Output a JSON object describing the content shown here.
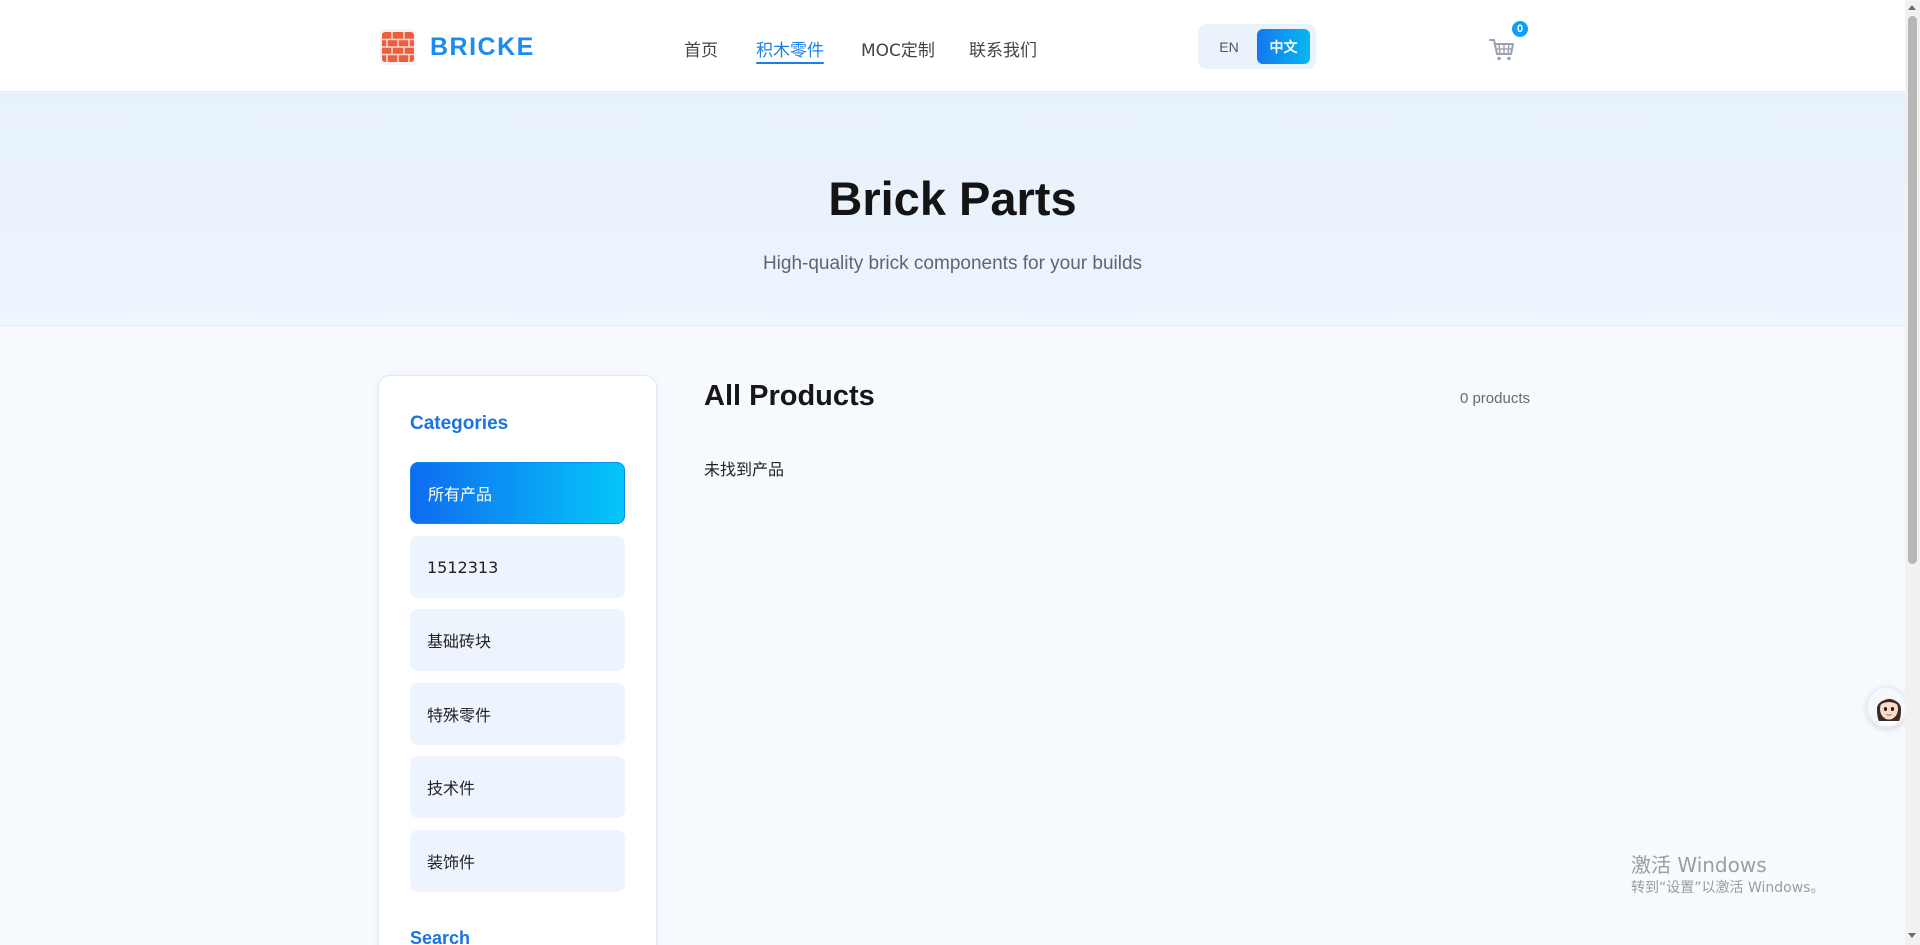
{
  "header": {
    "logo_text": "BRICKE",
    "nav": [
      {
        "label": "首页",
        "active": false
      },
      {
        "label": "积木零件",
        "active": true
      },
      {
        "label": "MOC定制",
        "active": false
      },
      {
        "label": "联系我们",
        "active": false
      }
    ],
    "lang": {
      "en": "EN",
      "zh": "中文",
      "selected": "中文"
    },
    "cart_count": "0"
  },
  "hero": {
    "title": "Brick Parts",
    "subtitle": "High-quality brick components for your builds"
  },
  "sidebar": {
    "categories_heading": "Categories",
    "categories": [
      {
        "label": "所有产品",
        "active": true
      },
      {
        "label": "1512313",
        "active": false
      },
      {
        "label": "基础砖块",
        "active": false
      },
      {
        "label": "特殊零件",
        "active": false
      },
      {
        "label": "技术件",
        "active": false
      },
      {
        "label": "装饰件",
        "active": false
      }
    ],
    "search_heading": "Search"
  },
  "main": {
    "title": "All Products",
    "count": "0 products",
    "empty_message": "未找到产品"
  },
  "watermark": {
    "title": "激活 Windows",
    "subtitle": "转到“设置”以激活 Windows。"
  },
  "colors": {
    "accent": "#1a7fe8",
    "accent_gradient_start": "#0f6cf0",
    "accent_gradient_end": "#05c6f8",
    "hero_bg": "#e7f1fc",
    "page_bg": "#f6f9fd"
  },
  "icons": {
    "logo": "brick-wall-icon",
    "cart": "shopping-cart-icon",
    "assistant": "assistant-avatar-icon"
  }
}
